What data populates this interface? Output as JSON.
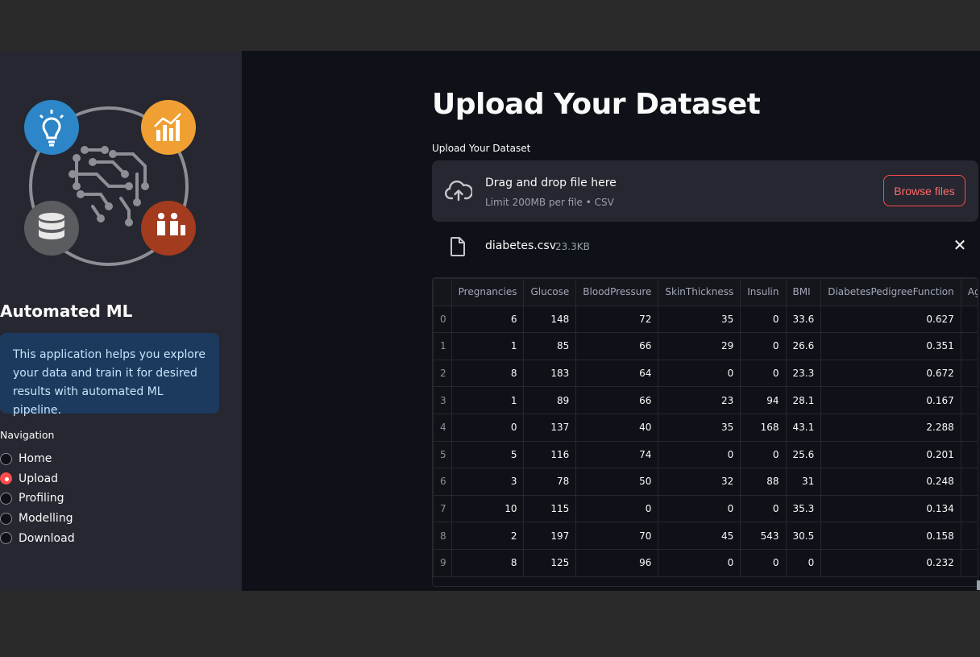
{
  "sidebar": {
    "title": "Automated ML",
    "info": "This application helps you explore your data and train it for desired results with automated ML pipeline.",
    "nav_label": "Navigation",
    "nav_items": [
      {
        "label": "Home",
        "selected": false
      },
      {
        "label": "Upload",
        "selected": true
      },
      {
        "label": "Profiling",
        "selected": false
      },
      {
        "label": "Modelling",
        "selected": false
      },
      {
        "label": "Download",
        "selected": false
      }
    ]
  },
  "main": {
    "title": "Upload Your Dataset",
    "upload_label": "Upload Your Dataset",
    "dropzone": {
      "title": "Drag and drop file here",
      "subtitle": "Limit 200MB per file • CSV",
      "button": "Browse files"
    },
    "file": {
      "name": "diabetes.csv",
      "size": "23.3KB"
    },
    "table": {
      "columns": [
        "",
        "Pregnancies",
        "Glucose",
        "BloodPressure",
        "SkinThickness",
        "Insulin",
        "BMI",
        "DiabetesPedigreeFunction",
        "Ag"
      ],
      "rows": [
        [
          "0",
          "6",
          "148",
          "72",
          "35",
          "0",
          "33.6",
          "0.627"
        ],
        [
          "1",
          "1",
          "85",
          "66",
          "29",
          "0",
          "26.6",
          "0.351"
        ],
        [
          "2",
          "8",
          "183",
          "64",
          "0",
          "0",
          "23.3",
          "0.672"
        ],
        [
          "3",
          "1",
          "89",
          "66",
          "23",
          "94",
          "28.1",
          "0.167"
        ],
        [
          "4",
          "0",
          "137",
          "40",
          "35",
          "168",
          "43.1",
          "2.288"
        ],
        [
          "5",
          "5",
          "116",
          "74",
          "0",
          "0",
          "25.6",
          "0.201"
        ],
        [
          "6",
          "3",
          "78",
          "50",
          "32",
          "88",
          "31",
          "0.248"
        ],
        [
          "7",
          "10",
          "115",
          "0",
          "0",
          "0",
          "35.3",
          "0.134"
        ],
        [
          "8",
          "2",
          "197",
          "70",
          "45",
          "543",
          "30.5",
          "0.158"
        ],
        [
          "9",
          "8",
          "125",
          "96",
          "0",
          "0",
          "0",
          "0.232"
        ]
      ]
    }
  },
  "colors": {
    "accent": "#ff4b4b",
    "sidebar_bg": "#262730",
    "main_bg": "#0e1117",
    "info_bg": "#1c3a5e"
  }
}
